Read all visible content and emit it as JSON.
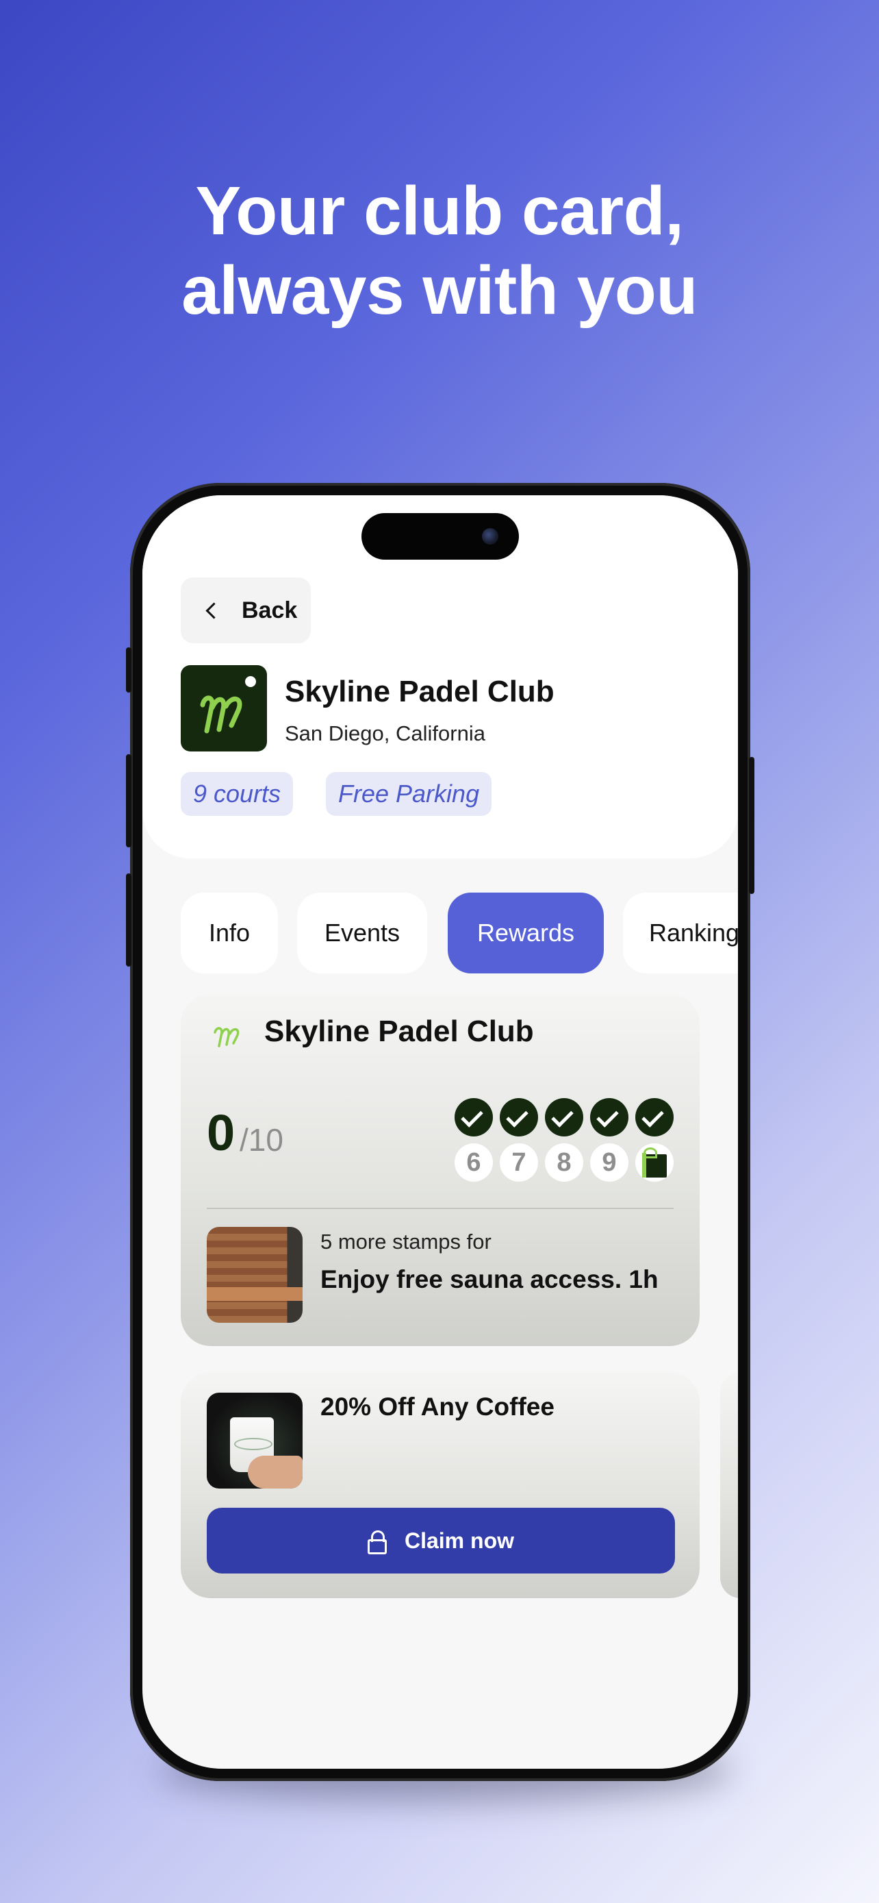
{
  "headline": {
    "line1": "Your club card,",
    "line2": "always with you"
  },
  "nav": {
    "back_label": "Back",
    "back_icon": "chevron-left-icon"
  },
  "club": {
    "name": "Skyline Padel Club",
    "location": "San Diego, California",
    "logo_glyph": "ɱ",
    "tags": [
      "9 courts",
      "Free Parking"
    ]
  },
  "tabs": [
    {
      "label": "Info",
      "active": false
    },
    {
      "label": "Events",
      "active": false
    },
    {
      "label": "Rewards",
      "active": true
    },
    {
      "label": "Rankings",
      "active": false
    }
  ],
  "stamp_card": {
    "title": "Skyline Padel Club",
    "count": "0",
    "total": "/10",
    "stamps_done": 5,
    "empty_slots": [
      "6",
      "7",
      "8",
      "9"
    ],
    "reward_subtitle": "5 more stamps for",
    "reward_title": "Enjoy free sauna access. 1h"
  },
  "offer": {
    "title": "20% Off Any Coffee",
    "claim_label": "Claim now",
    "claim_icon": "lock-icon"
  },
  "colors": {
    "accent": "#5661d8",
    "button": "#333da9",
    "brand_dark_green": "#14290e",
    "brand_lime": "#8fd14f"
  }
}
